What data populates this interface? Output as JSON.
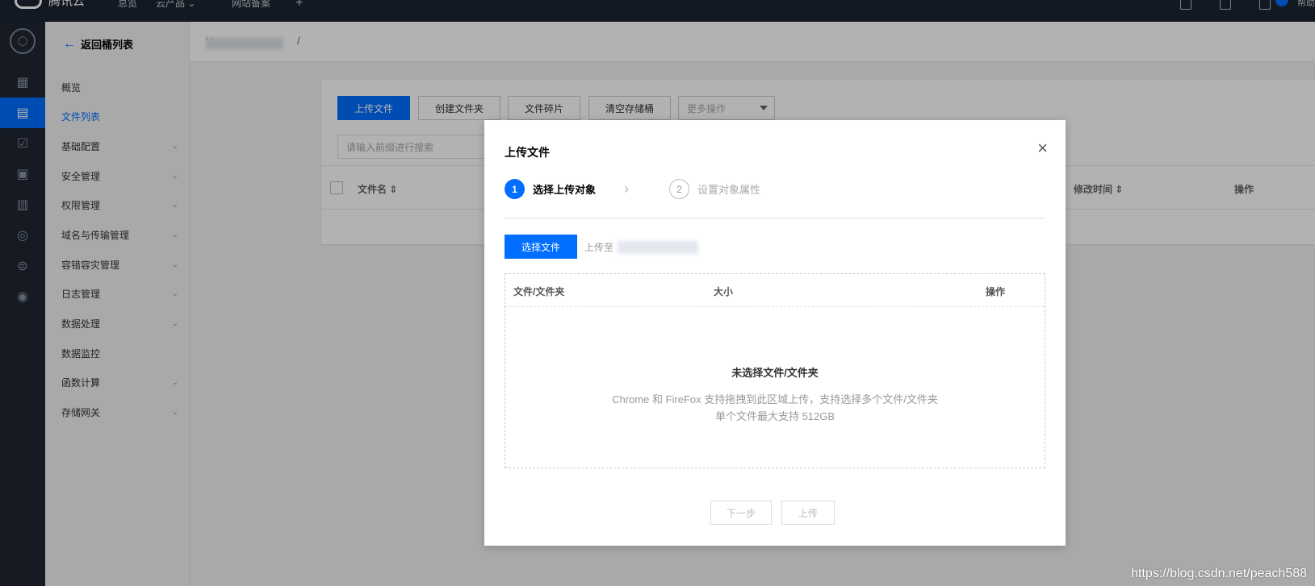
{
  "topbar": {
    "brand": "腾讯云",
    "nav": [
      "总览",
      "云产品",
      "网站备案",
      "+"
    ],
    "help": "帮助"
  },
  "rail": {
    "icons": [
      "grid-icon",
      "storage-icon",
      "checklist-icon",
      "monitor-icon",
      "calendar-icon",
      "shield-icon",
      "circle-icon",
      "security-icon"
    ]
  },
  "sidebar": {
    "back_label": "返回桶列表",
    "items": [
      {
        "label": "概览",
        "has_children": false
      },
      {
        "label": "文件列表",
        "has_children": false,
        "active": true
      },
      {
        "label": "基础配置",
        "has_children": true
      },
      {
        "label": "安全管理",
        "has_children": true
      },
      {
        "label": "权限管理",
        "has_children": true
      },
      {
        "label": "域名与传输管理",
        "has_children": true
      },
      {
        "label": "容错容灾管理",
        "has_children": true
      },
      {
        "label": "日志管理",
        "has_children": true
      },
      {
        "label": "数据处理",
        "has_children": true
      },
      {
        "label": "数据监控",
        "has_children": false
      },
      {
        "label": "函数计算",
        "has_children": true
      },
      {
        "label": "存储网关",
        "has_children": true
      }
    ]
  },
  "main": {
    "breadcrumb_prefix": "V",
    "breadcrumb_sep": "/",
    "toolbar": {
      "upload": "上传文件",
      "create_folder": "创建文件夹",
      "fragments": "文件碎片",
      "clear_bucket": "清空存储桶",
      "more_actions": "更多操作"
    },
    "search_placeholder": "请输入前缀进行搜索",
    "table_headers": {
      "name": "文件名 ⇕",
      "modified": "修改时间 ⇕",
      "actions": "操作"
    }
  },
  "modal": {
    "title": "上传文件",
    "close": "×",
    "steps": [
      {
        "num": "1",
        "label": "选择上传对象",
        "state": "active"
      },
      {
        "num": "2",
        "label": "设置对象属性",
        "state": "pending"
      }
    ],
    "choose_button": "选择文件",
    "upload_to_label": "上传至",
    "table_headers": {
      "name": "文件/文件夹",
      "size": "大小",
      "actions": "操作"
    },
    "empty_title": "未选择文件/文件夹",
    "empty_line1": "Chrome 和 FireFox 支持拖拽到此区域上传，支持选择多个文件/文件夹",
    "empty_line2": "单个文件最大支持 512GB",
    "next_button": "下一步",
    "upload_button": "上传"
  },
  "watermark": "https://blog.csdn.net/peach588",
  "colors": {
    "primary": "#006eff",
    "topbar": "#1b2431",
    "rail": "#1f2633"
  }
}
